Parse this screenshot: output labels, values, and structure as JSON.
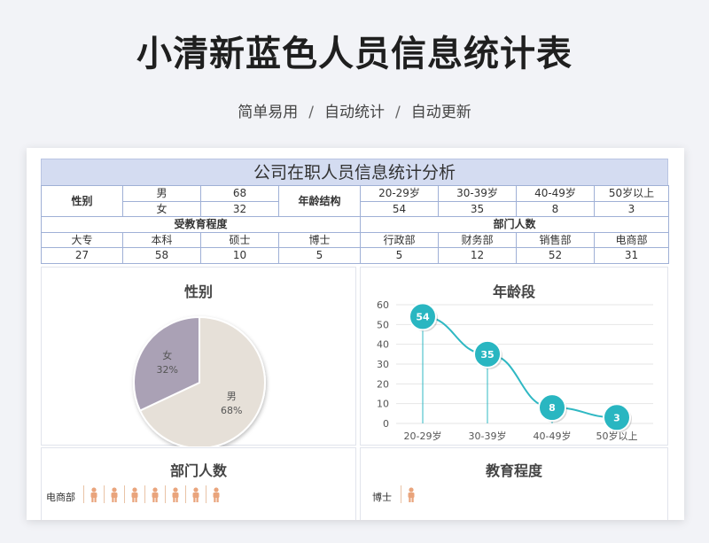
{
  "header": {
    "title": "小清新蓝色人员信息统计表",
    "subtitle_parts": [
      "简单易用",
      "自动统计",
      "自动更新"
    ],
    "separator": "/"
  },
  "sheet": {
    "title": "公司在职人员信息统计分析",
    "gender": {
      "label": "性别",
      "rows": [
        {
          "name": "男",
          "count": "68"
        },
        {
          "name": "女",
          "count": "32"
        }
      ]
    },
    "age_structure": {
      "label": "年龄结构",
      "headers": [
        "20-29岁",
        "30-39岁",
        "40-49岁",
        "50岁以上"
      ],
      "values": [
        "54",
        "35",
        "8",
        "3"
      ]
    },
    "education": {
      "label": "受教育程度",
      "headers": [
        "大专",
        "本科",
        "硕士",
        "博士"
      ],
      "values": [
        "27",
        "58",
        "10",
        "5"
      ]
    },
    "departments": {
      "label": "部门人数",
      "headers": [
        "行政部",
        "财务部",
        "销售部",
        "电商部"
      ],
      "values": [
        "5",
        "12",
        "52",
        "31"
      ]
    }
  },
  "panels": {
    "gender_title": "性别",
    "age_title": "年龄段",
    "dept_title": "部门人数",
    "edu_title": "教育程度",
    "dept_row_label": "电商部",
    "edu_row_label": "博士"
  },
  "colors": {
    "header_fill": "#d4dcf1",
    "grid_border": "#9fb0d6",
    "pie_male": "#e6e0d8",
    "pie_female": "#aaa1b5",
    "line": "#2fb8c3",
    "person": "#e9a47c"
  },
  "chart_data": [
    {
      "type": "pie",
      "title": "性别",
      "categories": [
        "男",
        "女"
      ],
      "values": [
        68,
        32
      ],
      "labels": [
        "68%",
        "32%"
      ]
    },
    {
      "type": "line",
      "title": "年龄段",
      "categories": [
        "20-29岁",
        "30-39岁",
        "40-49岁",
        "50岁以上"
      ],
      "values": [
        54,
        35,
        8,
        3
      ],
      "ylim": [
        0,
        60
      ],
      "yticks": [
        "0",
        "10",
        "20",
        "30",
        "40",
        "50",
        "60"
      ],
      "grid": true
    }
  ]
}
